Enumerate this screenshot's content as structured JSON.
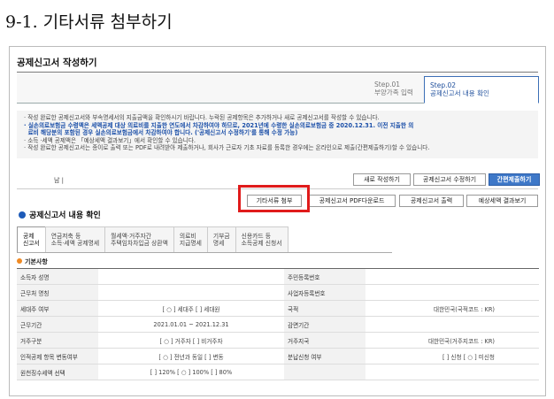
{
  "heading": "9-1. 기타서류 첨부하기",
  "app": {
    "title": "공제신고서 작성하기",
    "steps": [
      {
        "num": "Step.01",
        "label": "부양가족 입력"
      },
      {
        "num": "Step.02",
        "label": "공제신고서 내용 확인"
      }
    ]
  },
  "notices": [
    "작성 완료한 공제신고서와 부속명세서의 지출금액을 확인하시기 바랍니다. 누락된 공제항목은 추가하거나 새로 공제신고서를 작성할 수 있습니다.",
    "실손의료보험금 수령액은 세액공제 대상 의료비를 지출한 연도에서 차감하여야 하므로, 2021년에 수령한 실손의료보험금 중 2020.12.31. 이전 지출한 의",
    "료비 해당분의 포함된 경우 실손의료보험금에서 차감하여야 합니다. ('공제신고서 수정하기'를 통해 수정 가능)",
    "소득 ·세액 공제액은 「예상세액 결과보기」에서 확인할 수 있습니다.",
    "작성 완료한 공제신고서는 종이로 출력 또는 PDF로 내려받아 제출하거나, 회사가 근로자 기초 자료를 등록한 경우에는 온라인으로 제출(간편제출하기)할 수 있습니다."
  ],
  "pager": "남 |",
  "actions": {
    "new": "새로 작성하기",
    "edit": "공제신고서 수정하기",
    "submit": "간편제출하기"
  },
  "file_actions": {
    "attach": "기타서류 첨부",
    "pdf": "공제신고서 PDF다운로드",
    "print": "공제신고서 출력",
    "estimate": "예상세액 결과보기"
  },
  "section_title": "공제신고서 내용 확인",
  "tabs": [
    {
      "l1": "공제",
      "l2": "신고서"
    },
    {
      "l1": "연금저축 등",
      "l2": "소득·세액 공제명세"
    },
    {
      "l1": "월세액·거주자간",
      "l2": "주택임차차입금 상환액"
    },
    {
      "l1": "의료비",
      "l2": "지급명세"
    },
    {
      "l1": "기부금",
      "l2": "명세"
    },
    {
      "l1": "신용카드 등",
      "l2": "소득공제 신청서"
    }
  ],
  "basic": {
    "title": "기본사항",
    "rows": [
      {
        "k1": "소득자 성명",
        "v1": "",
        "k2": "주민등록번호",
        "v2": ""
      },
      {
        "k1": "근무처 명칭",
        "v1": "",
        "k2": "사업자등록번호",
        "v2": ""
      },
      {
        "k1": "세대주 여부",
        "v1": "[ ○ ] 세대주  [   ] 세대원",
        "k2": "국적",
        "v2": "대한민국(국적코드 : KR)"
      },
      {
        "k1": "근무기간",
        "v1": "2021.01.01 ~ 2021.12.31",
        "k2": "감면기간",
        "v2": ""
      },
      {
        "k1": "거주구분",
        "v1": "[ ○ ] 거주자  [   ] 비거주자",
        "k2": "거주지국",
        "v2": "대한민국(거주지코드 : KR)"
      },
      {
        "k1": "인적공제 항목 변동여부",
        "v1": "[ ○ ] 전년과 동일  [   ] 변동",
        "k2": "분납신청 여부",
        "v2": "[   ] 신청  [ ○ ] 미신청"
      },
      {
        "k1": "원천징수세액 선택",
        "v1": "[   ] 120%  [ ○ ] 100%  [   ] 80%",
        "k2": "",
        "v2": ""
      }
    ]
  }
}
